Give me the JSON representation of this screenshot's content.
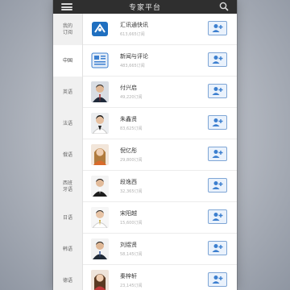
{
  "header": {
    "title": "专家平台"
  },
  "sidebar": {
    "items": [
      {
        "label": "我的订阅",
        "active": false
      },
      {
        "label": "中国",
        "active": true
      },
      {
        "label": "英语",
        "active": false
      },
      {
        "label": "法语",
        "active": false
      },
      {
        "label": "俄语",
        "active": false
      },
      {
        "label": "西班牙语",
        "active": false
      },
      {
        "label": "日语",
        "active": false
      },
      {
        "label": "韩语",
        "active": false
      },
      {
        "label": "德语",
        "active": false
      }
    ]
  },
  "list": {
    "rows": [
      {
        "name": "汇讯通快讯",
        "sub": "613,665订阅",
        "avatar": "logo-icon"
      },
      {
        "name": "新闻与评论",
        "sub": "483,665订阅",
        "avatar": "news-icon"
      },
      {
        "name": "付兴启",
        "sub": "49,220订阅",
        "avatar": "expert-avatar"
      },
      {
        "name": "朱鑫贤",
        "sub": "83,625订阅",
        "avatar": "expert-avatar"
      },
      {
        "name": "倪亿彤",
        "sub": "29,800订阅",
        "avatar": "expert-avatar"
      },
      {
        "name": "段逸西",
        "sub": "32,365订阅",
        "avatar": "expert-avatar"
      },
      {
        "name": "宋阳越",
        "sub": "15,600订阅",
        "avatar": "expert-avatar"
      },
      {
        "name": "刘煜贤",
        "sub": "58,145订阅",
        "avatar": "expert-avatar"
      },
      {
        "name": "秦梓轩",
        "sub": "23,145订阅",
        "avatar": "expert-avatar"
      }
    ]
  },
  "colors": {
    "topbar": "#2f2f2f",
    "accent": "#7fa6d6",
    "brand": "#1f6fc0"
  }
}
